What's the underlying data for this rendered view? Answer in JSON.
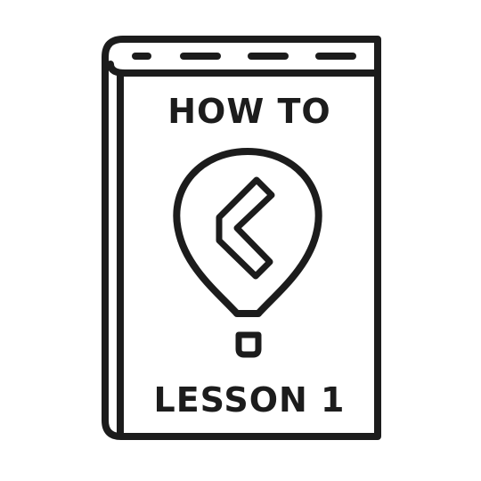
{
  "book": {
    "title_top": "HOW TO",
    "title_bottom": "LESSON 1"
  },
  "colors": {
    "ink": "#1c1c1c",
    "paper": "#ffffff"
  },
  "icons": {
    "emblem": "hot-air-balloon-logo-icon"
  }
}
